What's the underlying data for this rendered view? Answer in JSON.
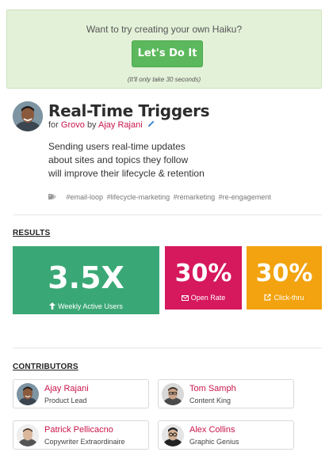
{
  "cta": {
    "question": "Want to try creating your own Haiku?",
    "button_label": "Let's Do It",
    "note": "(It'll only take 30 seconds)"
  },
  "haiku": {
    "title": "Real-Time Triggers",
    "for_word": "for",
    "company": "Grovo",
    "by_word": "by",
    "author": "Ajay Rajani",
    "lines": [
      "Sending users real-time updates",
      "about sites and topics they follow",
      "will improve their lifecycle & retention"
    ],
    "tags": [
      "#email-loop",
      "#lifecycle-marketing",
      "#remarketing",
      "#re-engagement"
    ]
  },
  "results": {
    "heading": "RESULTS",
    "items": [
      {
        "value": "3.5X",
        "label": "Weekly Active Users",
        "icon": "arrow-up-icon",
        "color": "#3aa876"
      },
      {
        "value": "30%",
        "label": "Open Rate",
        "icon": "envelope-icon",
        "color": "#d6185c"
      },
      {
        "value": "30%",
        "label": "Click-thru",
        "icon": "external-link-icon",
        "color": "#f2a30f"
      }
    ]
  },
  "contributors": {
    "heading": "CONTRIBUTORS",
    "people": [
      {
        "name": "Ajay Rajani",
        "role": "Product Lead"
      },
      {
        "name": "Tom Samph",
        "role": "Content King"
      },
      {
        "name": "Patrick Pellicacno",
        "role": "Copywriter Extraordinaire"
      },
      {
        "name": "Alex Collins",
        "role": "Graphic Genius"
      }
    ]
  },
  "colors": {
    "accent": "#c9154a",
    "cta_button": "#5cb85c",
    "cta_background": "#e3f1d9"
  }
}
